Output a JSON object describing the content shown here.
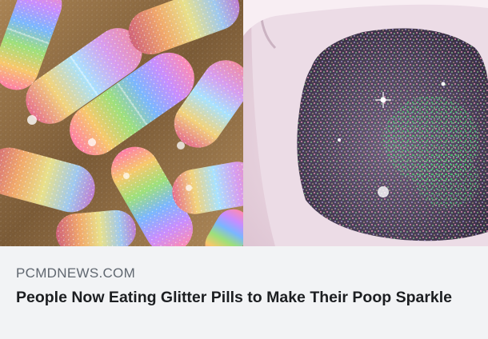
{
  "link_preview": {
    "domain": "PCMDNEWS.COM",
    "headline": "People Now Eating Glitter Pills to Make Their Poop Sparkle"
  },
  "colors": {
    "caption_background": "#f2f3f5",
    "domain_text": "#606770",
    "headline_text": "#1c1e21"
  },
  "images": {
    "left": "glitter-pills-photo",
    "right": "glitter-toilet-photo"
  }
}
